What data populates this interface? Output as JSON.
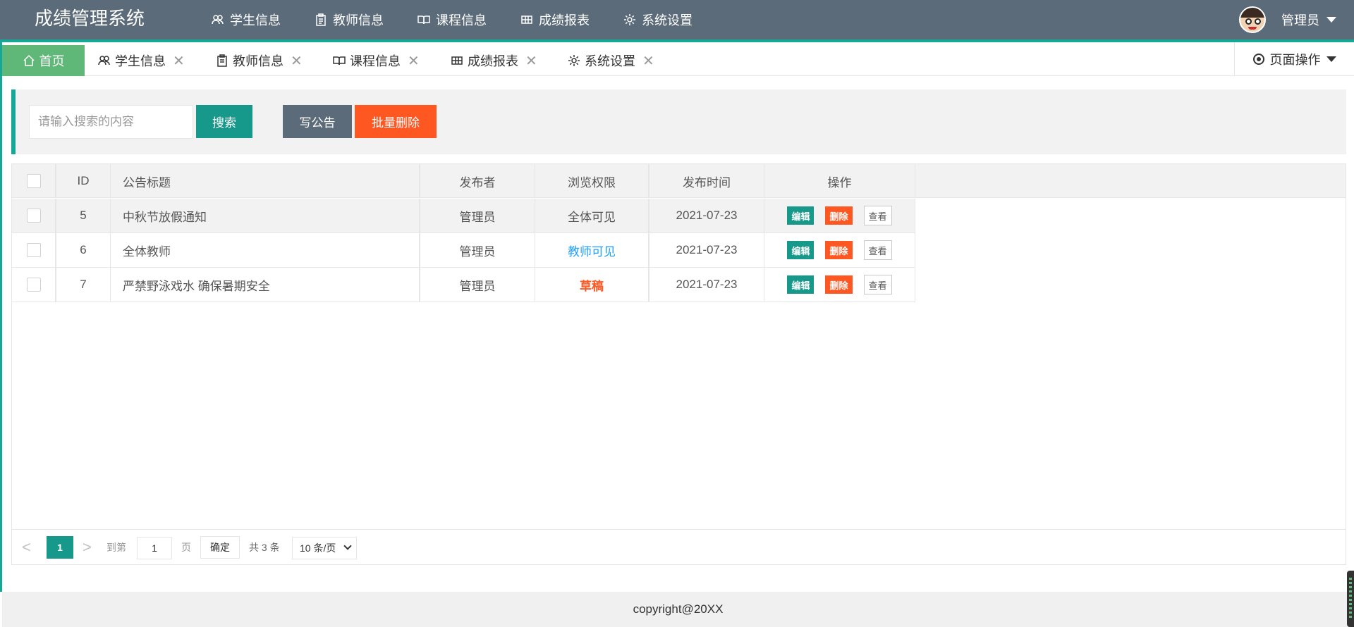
{
  "app": {
    "brand": "成绩管理系统"
  },
  "nav": [
    {
      "label": "学生信息",
      "icon": "users-icon"
    },
    {
      "label": "教师信息",
      "icon": "clipboard-icon"
    },
    {
      "label": "课程信息",
      "icon": "book-icon"
    },
    {
      "label": "成绩报表",
      "icon": "table-icon"
    },
    {
      "label": "系统设置",
      "icon": "gear-icon"
    }
  ],
  "user": {
    "name": "管理员"
  },
  "tabs": {
    "home": "首页",
    "items": [
      {
        "label": "学生信息",
        "icon": "users-icon"
      },
      {
        "label": "教师信息",
        "icon": "clipboard-icon"
      },
      {
        "label": "课程信息",
        "icon": "book-icon"
      },
      {
        "label": "成绩报表",
        "icon": "table-icon"
      },
      {
        "label": "系统设置",
        "icon": "gear-icon"
      }
    ],
    "close": "✕",
    "page_op": "页面操作"
  },
  "search": {
    "placeholder": "请输入搜索的内容",
    "search_label": "搜索",
    "write_label": "写公告",
    "batch_delete_label": "批量删除"
  },
  "table": {
    "headers": {
      "id": "ID",
      "title": "公告标题",
      "publisher": "发布者",
      "permission": "浏览权限",
      "time": "发布时间",
      "ops": "操作"
    },
    "rows": [
      {
        "id": "5",
        "title": "中秋节放假通知",
        "publisher": "管理员",
        "permission": "全体可见",
        "time": "2021-07-23"
      },
      {
        "id": "6",
        "title": "全体教师",
        "publisher": "管理员",
        "permission": "教师可见",
        "time": "2021-07-23"
      },
      {
        "id": "7",
        "title": "严禁野泳戏水 确保暑期安全",
        "publisher": "管理员",
        "permission": "草稿",
        "time": "2021-07-23"
      }
    ],
    "actions": {
      "edit": "编辑",
      "delete": "删除",
      "view": "查看"
    }
  },
  "pager": {
    "current": "1",
    "goto_label": "到第",
    "goto_value": "1",
    "page_label": "页",
    "ok_label": "确定",
    "total": "共 3 条",
    "per_page": "10 条/页",
    "prev": "<",
    "next": ">"
  },
  "footer": {
    "copyright": "copyright@20XX"
  },
  "colors": {
    "header": "#5b6b79",
    "accent": "#16a797",
    "home_tab": "#5fb878",
    "danger": "#ff5722",
    "primary_btn": "#16998a"
  }
}
